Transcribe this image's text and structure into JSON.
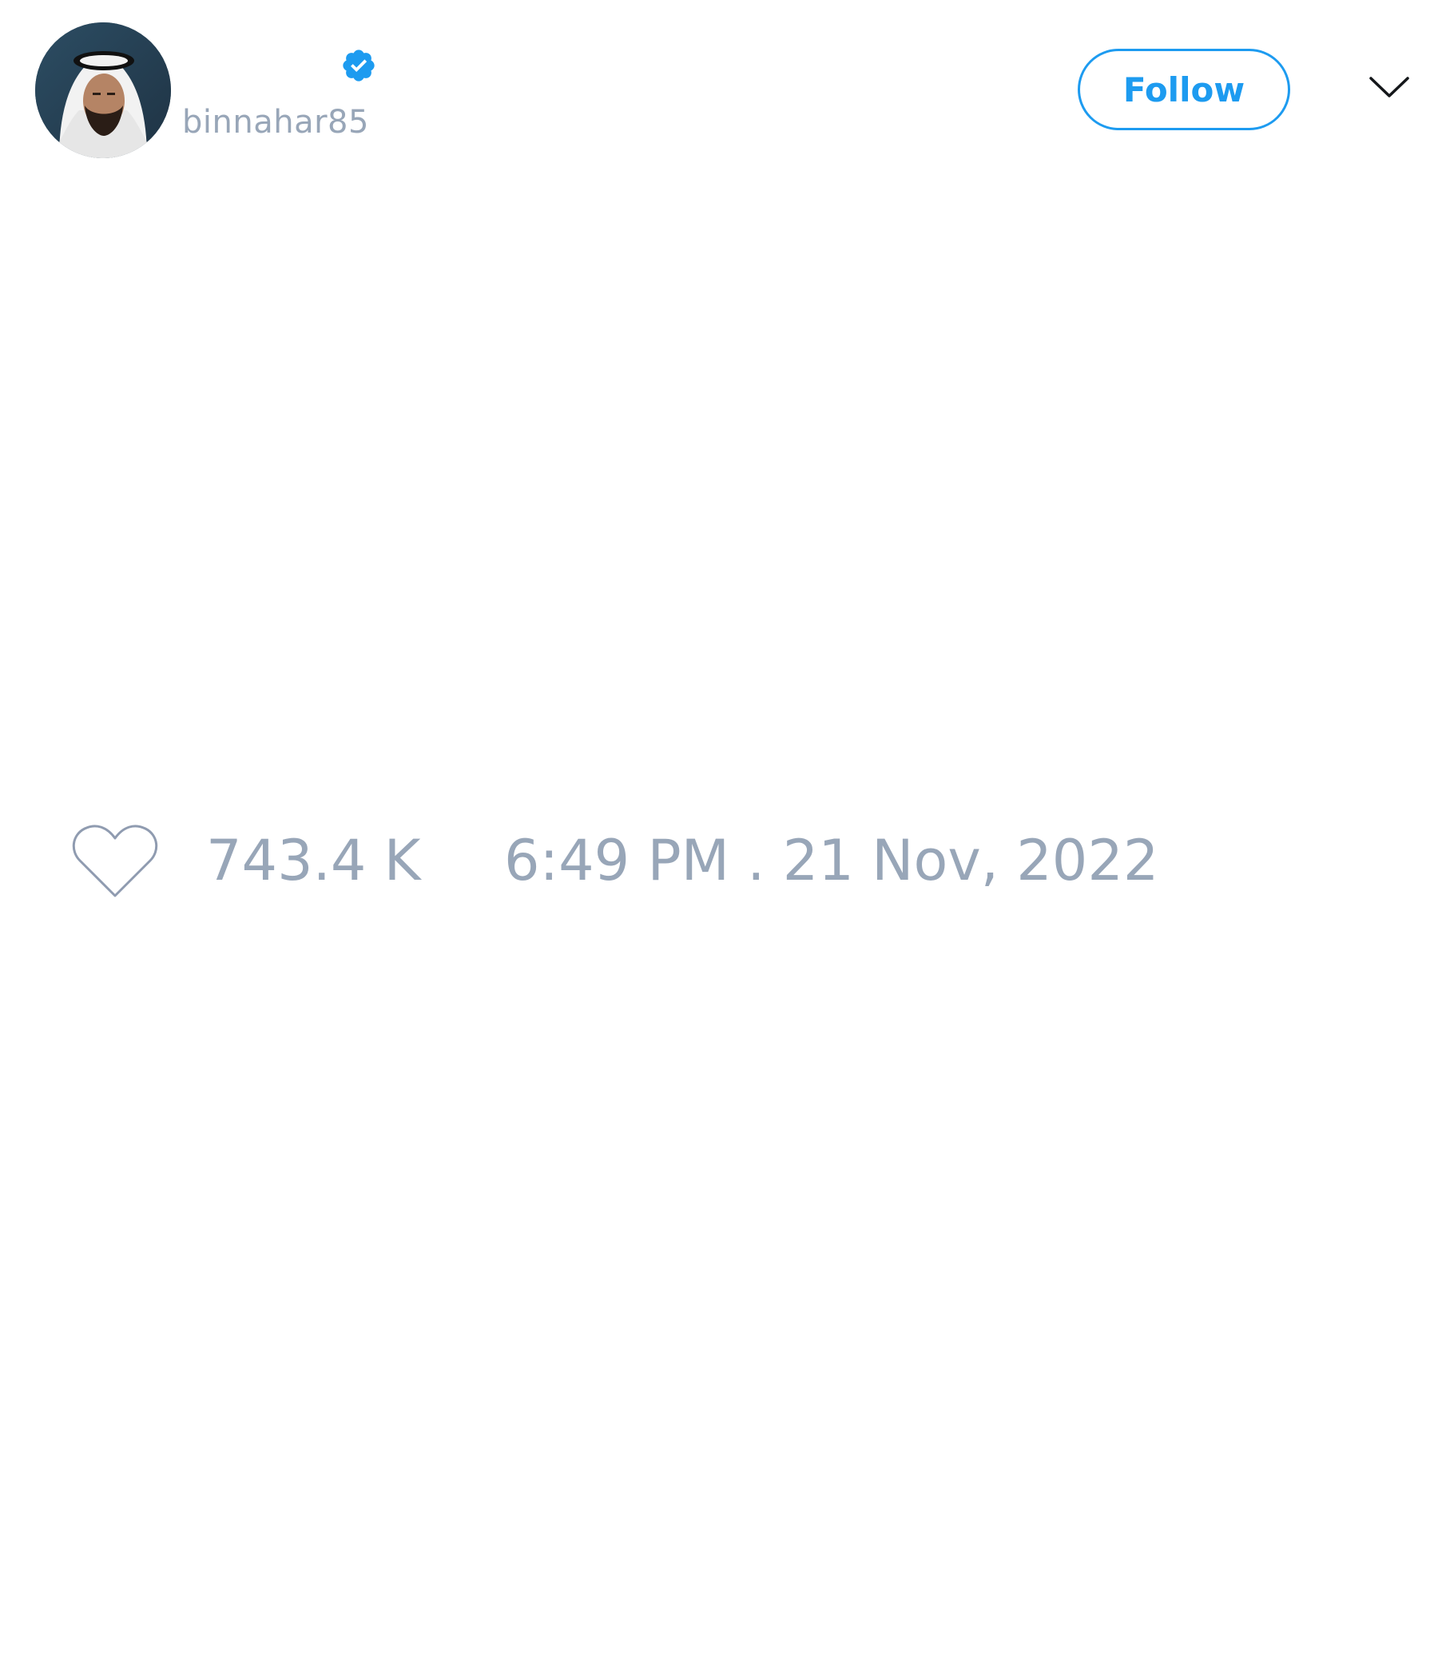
{
  "author": {
    "display_name": "",
    "handle": "binnahar85",
    "verified": true,
    "avatar": "profile-photo"
  },
  "actions": {
    "follow_label": "Follow",
    "more_icon": "chevron-down-icon"
  },
  "tweet": {
    "text": "",
    "like_count": "743.4 K",
    "timestamp": "6:49 PM . 21 Nov, 2022"
  },
  "icons": {
    "verified": "verified-badge-icon",
    "like": "heart-outline-icon"
  },
  "colors": {
    "accent": "#1d9bf0",
    "muted_text": "#98a6b8",
    "background": "#ffffff"
  }
}
